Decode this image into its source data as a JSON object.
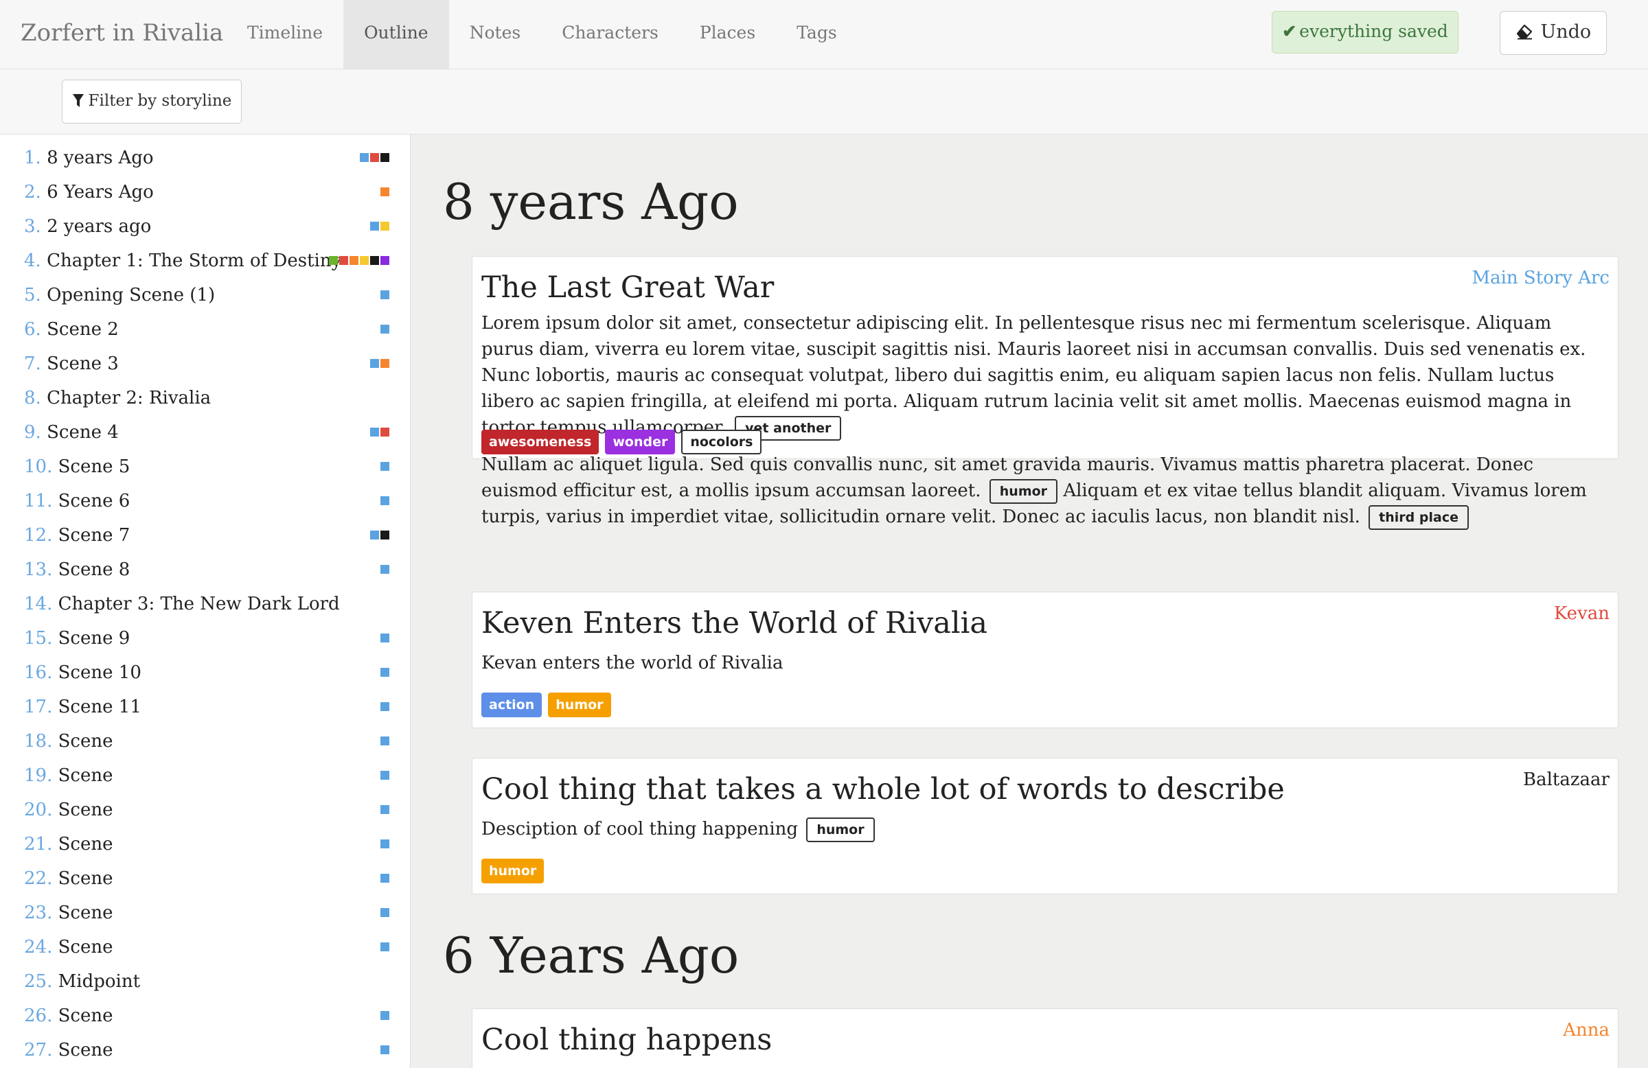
{
  "app": {
    "brand": "Zorfert in Rivalia",
    "tabs": [
      "Timeline",
      "Outline",
      "Notes",
      "Characters",
      "Places",
      "Tags"
    ],
    "active_tab": "Outline",
    "saved_label": "everything saved",
    "undo_label": "Undo"
  },
  "toolbar": {
    "filter_label": "Filter by storyline"
  },
  "colors": {
    "blue": "#5aa3e0",
    "red": "#e04b3f",
    "black": "#1a1a1a",
    "orange": "#f5852e",
    "yellow": "#f5c92e",
    "green": "#6ab42d",
    "purple": "#8a2be2"
  },
  "sidebar": {
    "items": [
      {
        "num": "1.",
        "label": "8 years Ago",
        "dots": [
          "#5aa3e0",
          "#e04b3f",
          "#1a1a1a"
        ]
      },
      {
        "num": "2.",
        "label": "6 Years Ago",
        "dots": [
          "#f5852e"
        ]
      },
      {
        "num": "3.",
        "label": "2 years ago",
        "dots": [
          "#5aa3e0",
          "#f5c92e"
        ]
      },
      {
        "num": "4.",
        "label": "Chapter 1: The Storm of Destiny",
        "dots": [
          "#6ab42d",
          "#e04b3f",
          "#f5852e",
          "#f5c92e",
          "#1a1a1a",
          "#8a2be2"
        ]
      },
      {
        "num": "5.",
        "label": "Opening Scene (1)",
        "dots": [
          "#5aa3e0"
        ]
      },
      {
        "num": "6.",
        "label": "Scene 2",
        "dots": [
          "#5aa3e0"
        ]
      },
      {
        "num": "7.",
        "label": "Scene 3",
        "dots": [
          "#5aa3e0",
          "#f5852e"
        ]
      },
      {
        "num": "8.",
        "label": "Chapter 2: Rivalia",
        "dots": []
      },
      {
        "num": "9.",
        "label": "Scene 4",
        "dots": [
          "#5aa3e0",
          "#e04b3f"
        ]
      },
      {
        "num": "10.",
        "label": "Scene 5",
        "dots": [
          "#5aa3e0"
        ]
      },
      {
        "num": "11.",
        "label": "Scene 6",
        "dots": [
          "#5aa3e0"
        ]
      },
      {
        "num": "12.",
        "label": "Scene 7",
        "dots": [
          "#5aa3e0",
          "#1a1a1a"
        ]
      },
      {
        "num": "13.",
        "label": "Scene 8",
        "dots": [
          "#5aa3e0"
        ]
      },
      {
        "num": "14.",
        "label": "Chapter 3: The New Dark Lord",
        "dots": []
      },
      {
        "num": "15.",
        "label": "Scene 9",
        "dots": [
          "#5aa3e0"
        ]
      },
      {
        "num": "16.",
        "label": "Scene 10",
        "dots": [
          "#5aa3e0"
        ]
      },
      {
        "num": "17.",
        "label": "Scene 11",
        "dots": [
          "#5aa3e0"
        ]
      },
      {
        "num": "18.",
        "label": "Scene",
        "dots": [
          "#5aa3e0"
        ]
      },
      {
        "num": "19.",
        "label": "Scene",
        "dots": [
          "#5aa3e0"
        ]
      },
      {
        "num": "20.",
        "label": "Scene",
        "dots": [
          "#5aa3e0"
        ]
      },
      {
        "num": "21.",
        "label": "Scene",
        "dots": [
          "#5aa3e0"
        ]
      },
      {
        "num": "22.",
        "label": "Scene",
        "dots": [
          "#5aa3e0"
        ]
      },
      {
        "num": "23.",
        "label": "Scene",
        "dots": [
          "#5aa3e0"
        ]
      },
      {
        "num": "24.",
        "label": "Scene",
        "dots": [
          "#5aa3e0"
        ]
      },
      {
        "num": "25.",
        "label": "Midpoint",
        "dots": []
      },
      {
        "num": "26.",
        "label": "Scene",
        "dots": [
          "#5aa3e0"
        ]
      },
      {
        "num": "27.",
        "label": "Scene",
        "dots": [
          "#5aa3e0"
        ]
      }
    ]
  },
  "main": {
    "chapter1": "8 years Ago",
    "chapter2": "6 Years Ago",
    "card1": {
      "title": "The Last Great War",
      "line": "Main Story Arc",
      "line_color": "#5aa3e0",
      "p1": "Lorem ipsum dolor sit amet, consectetur adipiscing elit. In pellentesque risus nec mi fermentum scelerisque. Aliquam purus diam, viverra eu lorem vitae, suscipit sagittis nisi. Mauris laoreet nisi in accumsan convallis. Duis sed venenatis ex. Nunc lobortis, mauris ac consequat volutpat, libero dui sagittis enim, eu aliquam sapien lacus non felis. Nullam luctus libero ac sapien fringilla, at eleifend mi porta. Aliquam rutrum lacinia velit sit amet mollis. Maecenas euismod magna in tortor tempus ullamcorper.",
      "p1_tag": "yet another",
      "p2a": "Nullam ac aliquet ligula. Sed quis convallis nunc, sit amet gravida mauris. Vivamus mattis pharetra placerat. Donec euismod efficitur est, a mollis ipsum accumsan laoreet.",
      "p2_tag1": "humor",
      "p2b": "Aliquam et ex vitae tellus blandit aliquam. Vivamus lorem turpis, varius in imperdiet vitae, sollicitudin ornare velit. Donec ac iaculis lacus, non blandit nisl.",
      "p2_tag2": "third place",
      "tags": [
        {
          "label": "awesomeness",
          "color": "#c0262b"
        },
        {
          "label": "wonder",
          "color": "#9b30e0"
        },
        {
          "label": "nocolors",
          "color": ""
        }
      ]
    },
    "card2": {
      "title": "Keven Enters the World of Rivalia",
      "line": "Kevan",
      "line_color": "#e04b3f",
      "desc": "Kevan enters the world of Rivalia",
      "tags": [
        {
          "label": "action",
          "color": "#5d8fe8"
        },
        {
          "label": "humor",
          "color": "#f5a000"
        }
      ]
    },
    "card3": {
      "title": "Cool thing that takes a whole lot of words to describe",
      "line": "Baltazaar",
      "line_color": "#222222",
      "desc": "Desciption of cool thing happening",
      "desc_tag": "humor",
      "tags": [
        {
          "label": "humor",
          "color": "#f5a000"
        }
      ]
    },
    "card4": {
      "title": "Cool thing happens",
      "line": "Anna",
      "line_color": "#f5852e"
    }
  }
}
